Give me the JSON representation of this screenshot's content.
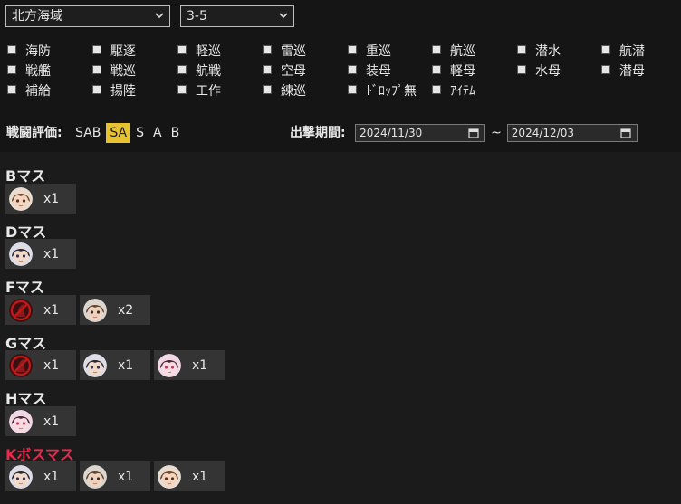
{
  "selects": {
    "area": "北方海域",
    "map": "3-5"
  },
  "ship_types": [
    [
      "海防",
      "駆逐",
      "軽巡",
      "雷巡",
      "重巡",
      "航巡",
      "潜水",
      "航潜"
    ],
    [
      "戦艦",
      "戦巡",
      "航戦",
      "空母",
      "装母",
      "軽母",
      "水母",
      "潜母"
    ],
    [
      "補給",
      "揚陸",
      "工作",
      "練巡",
      "ﾄﾞﾛｯﾌﾟ無",
      "ｱｲﾃﾑ"
    ]
  ],
  "rating": {
    "label": "戦闘評価:",
    "options": [
      "SAB",
      "SA",
      "S",
      "A",
      "B"
    ],
    "active": "SA"
  },
  "period": {
    "label": "出撃期間:",
    "from": "2024/11/30",
    "to": "2024/12/03",
    "sep": "~"
  },
  "nodes": [
    {
      "name": "Bマス",
      "boss": false,
      "drops": [
        {
          "icon": "brown-hair-girl-icon",
          "count": "x1"
        }
      ]
    },
    {
      "name": "Dマス",
      "boss": false,
      "drops": [
        {
          "icon": "dark-hair-girl-icon",
          "count": "x1"
        }
      ]
    },
    {
      "name": "Fマス",
      "boss": false,
      "drops": [
        {
          "icon": "no-drop-icon",
          "count": "x1"
        },
        {
          "icon": "brown-hair-boy-icon",
          "count": "x2"
        }
      ]
    },
    {
      "name": "Gマス",
      "boss": false,
      "drops": [
        {
          "icon": "no-drop-icon",
          "count": "x1"
        },
        {
          "icon": "dark-hair-girl-icon",
          "count": "x1"
        },
        {
          "icon": "pink-hair-girl-icon",
          "count": "x1"
        }
      ]
    },
    {
      "name": "Hマス",
      "boss": false,
      "drops": [
        {
          "icon": "pink-hair-girl-icon",
          "count": "x1"
        }
      ]
    },
    {
      "name": "Kボスマス",
      "boss": true,
      "drops": [
        {
          "icon": "dark-hair-girl-icon",
          "count": "x1"
        },
        {
          "icon": "brown-hair-boy-icon",
          "count": "x1"
        },
        {
          "icon": "brown-hair-girl-icon",
          "count": "x1"
        }
      ]
    }
  ]
}
